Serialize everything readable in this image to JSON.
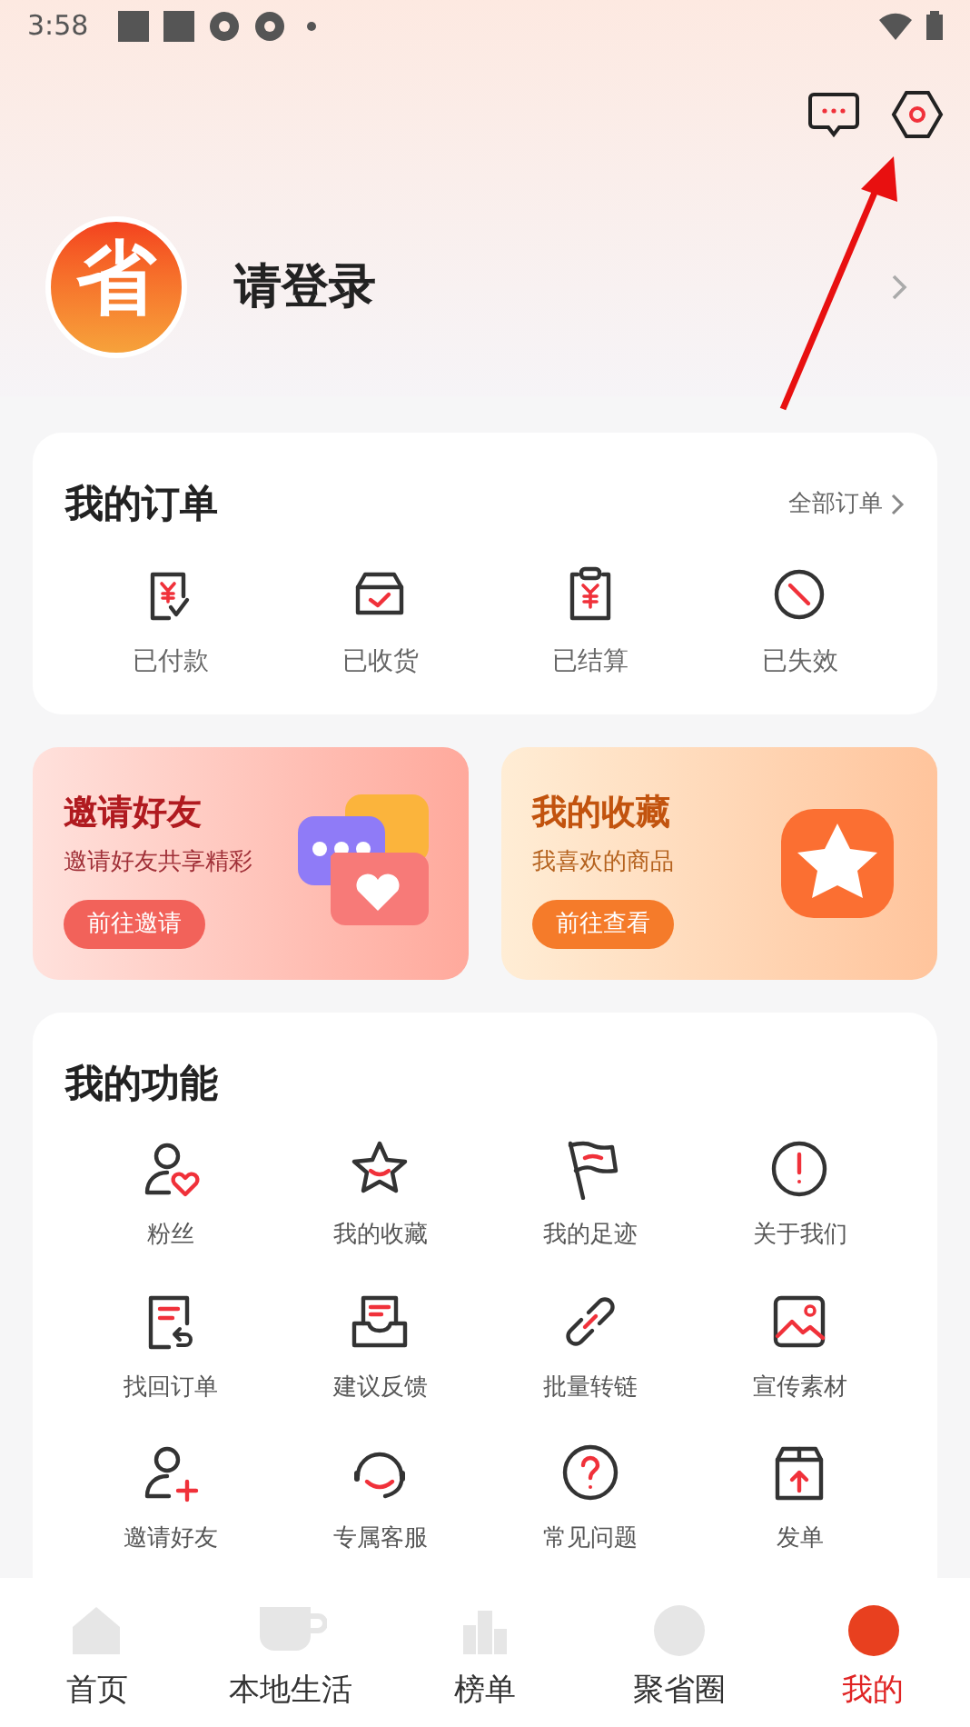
{
  "status_bar": {
    "time": "3:58"
  },
  "profile": {
    "avatar_text": "省",
    "login_prompt": "请登录"
  },
  "orders": {
    "title": "我的订单",
    "all_link": "全部订单",
    "items": [
      {
        "label": "已付款"
      },
      {
        "label": "已收货"
      },
      {
        "label": "已结算"
      },
      {
        "label": "已失效"
      }
    ]
  },
  "banners": [
    {
      "title": "邀请好友",
      "subtitle": "邀请好友共享精彩",
      "button": "前往邀请"
    },
    {
      "title": "我的收藏",
      "subtitle": "我喜欢的商品",
      "button": "前往查看"
    }
  ],
  "functions": {
    "title": "我的功能",
    "items": [
      {
        "label": "粉丝"
      },
      {
        "label": "我的收藏"
      },
      {
        "label": "我的足迹"
      },
      {
        "label": "关于我们"
      },
      {
        "label": "找回订单"
      },
      {
        "label": "建议反馈"
      },
      {
        "label": "批量转链"
      },
      {
        "label": "宣传素材"
      },
      {
        "label": "邀请好友"
      },
      {
        "label": "专属客服"
      },
      {
        "label": "常见问题"
      },
      {
        "label": "发单"
      }
    ]
  },
  "bottom_nav": [
    {
      "label": "首页",
      "selected": false
    },
    {
      "label": "本地生活",
      "selected": false
    },
    {
      "label": "榜单",
      "selected": false
    },
    {
      "label": "聚省圈",
      "selected": false
    },
    {
      "label": "我的",
      "selected": true
    }
  ]
}
